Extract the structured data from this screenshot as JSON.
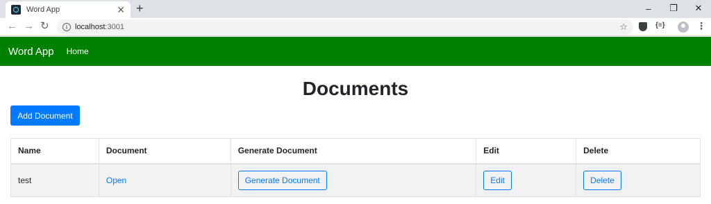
{
  "browser": {
    "tab_title": "Word App",
    "tab_close": "✕",
    "new_tab": "+",
    "url_host": "localhost",
    "url_port": ":3001",
    "window_controls": {
      "minimize": "–",
      "restore": "❐",
      "close": "✕"
    },
    "nav": {
      "back": "←",
      "forward": "→",
      "reload": "↻"
    },
    "star": "☆",
    "ext_brackets": "{≡}",
    "menu": "⋮"
  },
  "navbar": {
    "brand": "Word App",
    "links": [
      "Home"
    ],
    "color": "#008000"
  },
  "page": {
    "title": "Documents",
    "add_button": "Add Document"
  },
  "table": {
    "headers": [
      "Name",
      "Document",
      "Generate Document",
      "Edit",
      "Delete"
    ],
    "rows": [
      {
        "name": "test",
        "document_link": "Open",
        "generate_button": "Generate Document",
        "edit_button": "Edit",
        "delete_button": "Delete"
      }
    ]
  },
  "colors": {
    "primary": "#007bff",
    "row_stripe": "#f2f2f2"
  }
}
